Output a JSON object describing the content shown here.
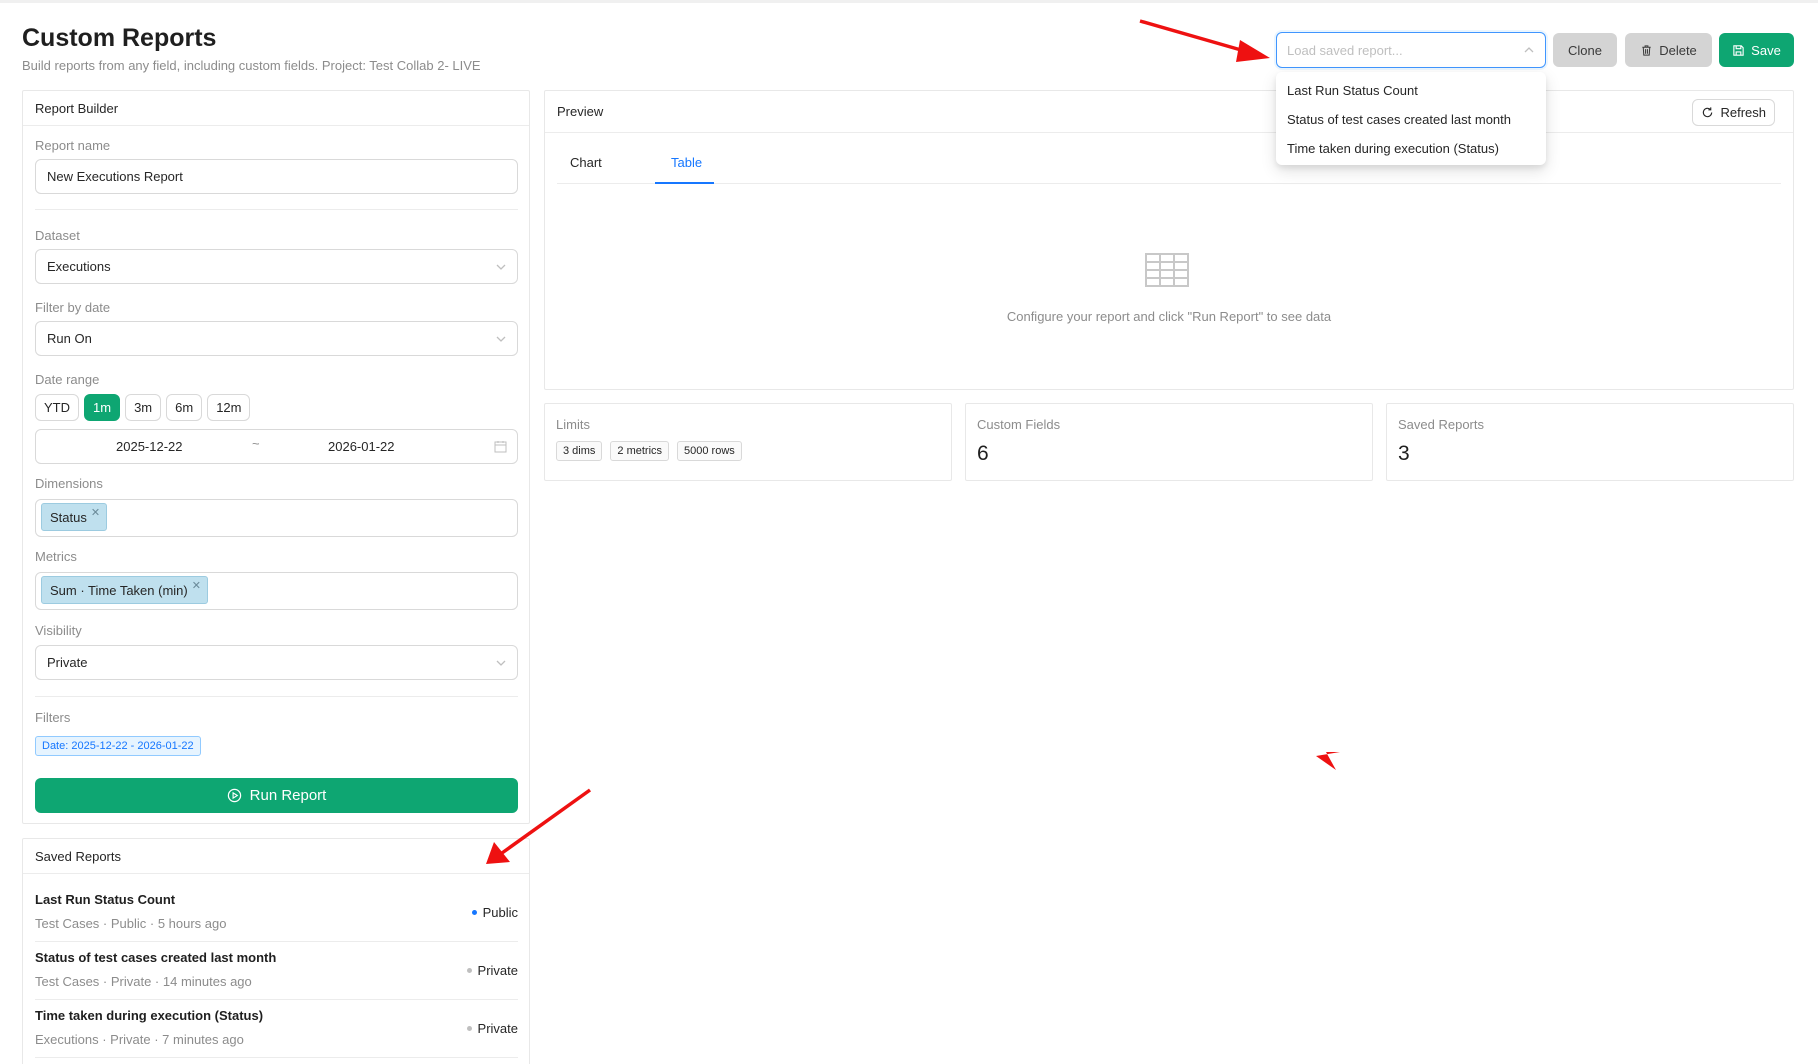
{
  "header": {
    "title": "Custom Reports",
    "subtitle": "Build reports from any field, including custom fields. Project: Test Collab 2- LIVE",
    "load_placeholder": "Load saved report...",
    "clone_label": "Clone",
    "delete_label": "Delete",
    "save_label": "Save"
  },
  "dropdown": {
    "options": [
      "Last Run Status Count",
      "Status of test cases created last month",
      "Time taken during execution (Status)"
    ]
  },
  "builder": {
    "title": "Report Builder",
    "report_name_label": "Report name",
    "report_name_value": "New Executions Report",
    "dataset_label": "Dataset",
    "dataset_value": "Executions",
    "filter_date_label": "Filter by date",
    "filter_date_value": "Run On",
    "date_range_label": "Date range",
    "range_buttons": [
      "YTD",
      "1m",
      "3m",
      "6m",
      "12m"
    ],
    "range_active": "1m",
    "date_start": "2025-12-22",
    "date_sep": "~",
    "date_end": "2026-01-22",
    "dimensions_label": "Dimensions",
    "dimension_tag": "Status",
    "metrics_label": "Metrics",
    "metric_tag": "Sum · Time Taken (min)",
    "visibility_label": "Visibility",
    "visibility_value": "Private",
    "filters_label": "Filters",
    "filter_chip": "Date: 2025-12-22 - 2026-01-22",
    "run_label": "Run Report"
  },
  "saved_reports": {
    "title": "Saved Reports",
    "items": [
      {
        "name": "Last Run Status Count",
        "meta": "Test Cases · Public · 5 hours ago",
        "visibility": "Public"
      },
      {
        "name": "Status of test cases created last month",
        "meta": "Test Cases · Private · 14 minutes ago",
        "visibility": "Private"
      },
      {
        "name": "Time taken during execution (Status)",
        "meta": "Executions · Private · 7 minutes ago",
        "visibility": "Private"
      }
    ]
  },
  "preview": {
    "title": "Preview",
    "refresh_label": "Refresh",
    "tabs": [
      "Chart",
      "Table"
    ],
    "active_tab": "Table",
    "empty_text": "Configure your report and click \"Run Report\" to see data"
  },
  "stats": {
    "limits_label": "Limits",
    "limits": [
      "3 dims",
      "2 metrics",
      "5000 rows"
    ],
    "custom_fields_label": "Custom Fields",
    "custom_fields_value": "6",
    "saved_reports_label": "Saved Reports",
    "saved_reports_value": "3"
  },
  "colors": {
    "primary_green": "#0ea672",
    "accent_blue": "#1677ff",
    "annotation_red": "#ee1111"
  }
}
